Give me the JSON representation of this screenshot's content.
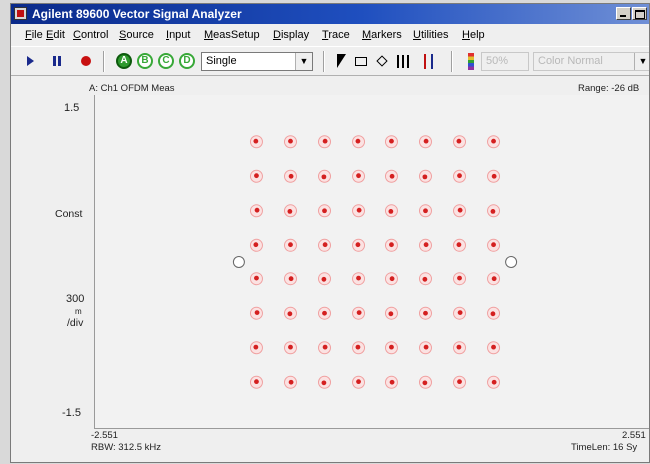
{
  "window": {
    "title": "Agilent 89600 Vector Signal Analyzer"
  },
  "menu": [
    "File",
    "Edit",
    "Control",
    "Source",
    "Input",
    "MeasSetup",
    "Display",
    "Trace",
    "Markers",
    "Utilities",
    "Help"
  ],
  "toolbar": {
    "trigger_a": "A",
    "trigger_b": "B",
    "trigger_c": "C",
    "trigger_d": "D",
    "mode": "Single",
    "percent": "50%",
    "color_mode": "Color Normal"
  },
  "trace": {
    "title": "A: Ch1 OFDM Meas",
    "range": "Range: -26 dB",
    "y_top": "1.5",
    "y_format": "Const",
    "y_scale_1": "300",
    "y_scale_2": "m",
    "y_scale_3": "/div",
    "y_bottom": "-1.5",
    "x_left": "-2.551",
    "x_right": "2.551",
    "rbw": "RBW: 312.5 kHz",
    "timelen": "TimeLen: 16 Sy"
  },
  "chart_data": {
    "type": "scatter",
    "title": "A: Ch1 OFDM Meas",
    "ylim": [
      -1.5,
      1.5
    ],
    "xlim": [
      -2.551,
      2.551
    ],
    "grid": false,
    "series": [
      {
        "values_i": [
          -1.08,
          -0.77,
          -0.46,
          -0.15,
          0.15,
          0.46,
          0.77,
          1.08
        ],
        "values_q": [
          -1.08,
          -0.77,
          -0.46,
          -0.15,
          0.15,
          0.46,
          0.77,
          1.08
        ]
      }
    ],
    "pilots": [
      {
        "x": -1.24,
        "y": 0
      },
      {
        "x": 1.24,
        "y": 0
      }
    ],
    "colors": {
      "symbol": "#d42020",
      "ring": "#f0a0a0",
      "pilot": "#ffffff"
    }
  }
}
